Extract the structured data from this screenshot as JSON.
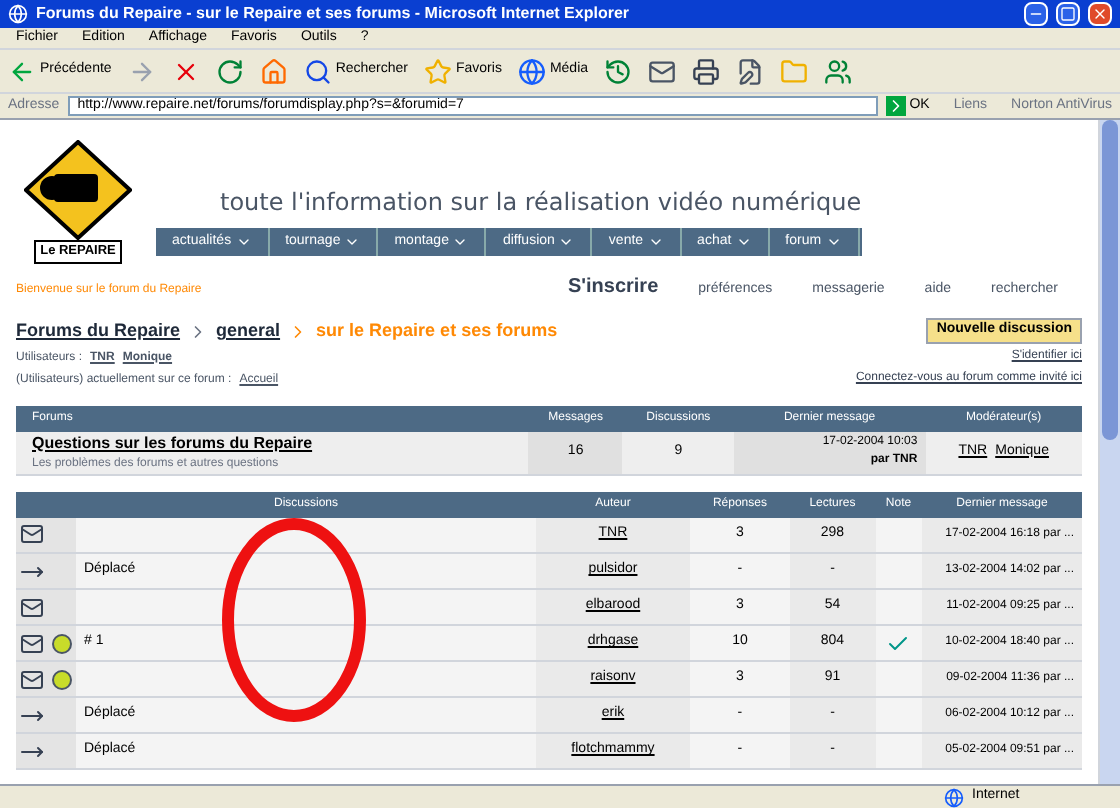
{
  "window": {
    "title": "Forums du Repaire - sur le Repaire et ses forums - Microsoft Internet Explorer"
  },
  "menu": [
    "Fichier",
    "Edition",
    "Affichage",
    "Favoris",
    "Outils",
    "?"
  ],
  "toolbar": [
    {
      "kind": "back",
      "label": "Précédente"
    },
    {
      "kind": "forward"
    },
    {
      "kind": "stop"
    },
    {
      "kind": "refresh"
    },
    {
      "kind": "home"
    },
    {
      "kind": "search",
      "label": "Rechercher"
    },
    {
      "kind": "favorites",
      "label": "Favoris"
    },
    {
      "kind": "media",
      "label": "Média"
    },
    {
      "kind": "history"
    },
    {
      "kind": "mail"
    },
    {
      "kind": "print"
    },
    {
      "kind": "edit"
    },
    {
      "kind": "folder"
    },
    {
      "kind": "messenger"
    }
  ],
  "address": {
    "label": "Adresse",
    "value": "http://www.repaire.net/forums/forumdisplay.php?s=&forumid=7",
    "go": "OK",
    "links": "Liens",
    "extra": "Norton AntiVirus"
  },
  "site": {
    "logo": "Le REPAIRE",
    "tagline": "toute l'information sur la réalisation vidéo numérique",
    "nav": [
      "actualités",
      "tournage",
      "montage",
      "diffusion",
      "vente",
      "achat",
      "forum"
    ],
    "welcome": "Bienvenue sur le forum du Repaire",
    "links": [
      {
        "label": "S'inscrire",
        "big": true
      },
      {
        "label": "préférences",
        "big": false
      },
      {
        "label": "messagerie",
        "big": false
      },
      {
        "label": "aide",
        "big": false
      },
      {
        "label": "rechercher",
        "big": false
      }
    ]
  },
  "breadcrumb": {
    "items": [
      "Forums du Repaire",
      "general"
    ],
    "current": "sur le Repaire et ses forums"
  },
  "online": {
    "label": "Utilisateurs :",
    "users": [
      "TNR",
      "Monique"
    ],
    "note": "(Utilisateurs) actuellement sur ce forum :",
    "link": "Accueil"
  },
  "actions": {
    "new_topic": "Nouvelle discussion",
    "links": [
      "S'identifier ici",
      "Connectez-vous au forum comme invité ici"
    ]
  },
  "forum_table": {
    "columns": [
      "Forums",
      "Messages",
      "Discussions",
      "Dernier message",
      "Modérateur(s)"
    ],
    "rows": [
      {
        "title": "Questions sur les forums du Repaire",
        "description": "Les problèmes des forums et autres questions",
        "messages": "16",
        "topics": "9",
        "last_date": "17-02-2004 10:03",
        "last_by": "par TNR",
        "moderators": [
          "TNR",
          "Monique"
        ]
      }
    ]
  },
  "topic_table": {
    "columns": [
      "Discussions",
      "Auteur",
      "Réponses",
      "Lectures",
      "Note",
      "Dernier message"
    ],
    "rows": [
      {
        "kind": "open",
        "hot": false,
        "title": "",
        "author": "TNR",
        "replies": "3",
        "views": "298",
        "rated": false,
        "last": "17-02-2004 16:18 par ..."
      },
      {
        "kind": "moved",
        "hot": false,
        "title": "Déplacé",
        "author": "pulsidor",
        "replies": "-",
        "views": "-",
        "rated": false,
        "last": "13-02-2004 14:02 par ..."
      },
      {
        "kind": "open",
        "hot": false,
        "title": "",
        "author": "elbarood",
        "replies": "3",
        "views": "54",
        "rated": false,
        "last": "11-02-2004 09:25 par ..."
      },
      {
        "kind": "open",
        "hot": true,
        "title": "# 1",
        "author": "drhgase",
        "replies": "10",
        "views": "804",
        "rated": true,
        "last": "10-02-2004 18:40 par ..."
      },
      {
        "kind": "open",
        "hot": true,
        "title": "",
        "author": "raisonv",
        "replies": "3",
        "views": "91",
        "rated": false,
        "last": "09-02-2004 11:36 par ..."
      },
      {
        "kind": "moved",
        "hot": false,
        "title": "Déplacé",
        "author": "erik",
        "replies": "-",
        "views": "-",
        "rated": false,
        "last": "06-02-2004 10:12 par ..."
      },
      {
        "kind": "moved",
        "hot": false,
        "title": "Déplacé",
        "author": "flotchmammy",
        "replies": "-",
        "views": "-",
        "rated": false,
        "last": "05-02-2004 09:51 par ..."
      }
    ]
  },
  "status_bar": {
    "zone": "Internet"
  }
}
